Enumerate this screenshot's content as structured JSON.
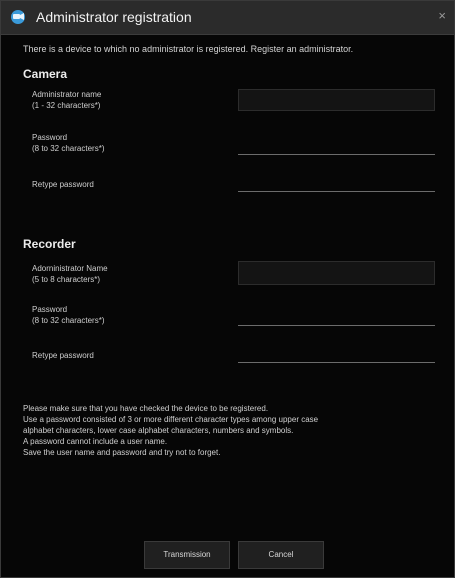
{
  "window": {
    "title": "Administrator registration",
    "close_symbol": "×",
    "icon": "app-icon"
  },
  "intro_text": "There is a device to which no administrator is registered.  Register an administrator.",
  "camera": {
    "heading": "Camera",
    "admin_name_label": "Administrator name\n(1 - 32 characters*)",
    "password_label": "Password\n(8 to 32 characters*)",
    "retype_label": "Retype password"
  },
  "recorder": {
    "heading": "Recorder",
    "admin_name_label": "Adorninistrator Name\n(5 to 8 characters*)",
    "password_label": "Password\n(8 to 32 characters*)",
    "retype_label": "Retype password"
  },
  "notes": [
    "Please make sure that you have checked the device to be registered.",
    "Use a password consisted of 3 or more different character types among upper case",
    "alphabet characters, lower case alphabet characters, numbers and symbols.",
    "A password cannot include a user name.",
    "Save the user name and password and try not to forget."
  ],
  "buttons": {
    "transmission": "Transmission",
    "cancel": "Cancel"
  }
}
